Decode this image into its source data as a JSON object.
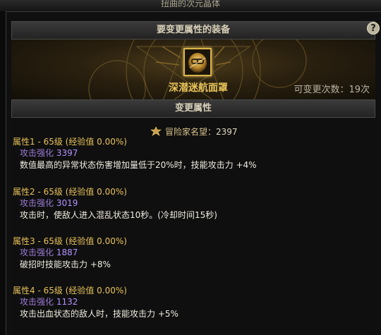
{
  "window": {
    "title": "扭曲的次元晶体"
  },
  "help": {
    "label": "?"
  },
  "equip_section": {
    "header": "要变更属性的装备",
    "item_name": "深潜迷航面罩",
    "change_count": "可变更次数：19次"
  },
  "attr_section": {
    "header": "变更属性",
    "renown_label": "冒险家名望：",
    "renown_value": "2397",
    "attributes": [
      {
        "title": "属性1 - 65级 (经验值 0.00%)",
        "enhance_label": "攻击强化",
        "enhance_value": "3397",
        "effect": "数值最高的异常状态伤害增加量低于20%时，技能攻击力 +4%"
      },
      {
        "title": "属性2 - 65级 (经验值 0.00%)",
        "enhance_label": "攻击强化",
        "enhance_value": "3019",
        "effect": "攻击时，使敌人进入混乱状态10秒。(冷却时间15秒)"
      },
      {
        "title": "属性3 - 65级 (经验值 0.00%)",
        "enhance_label": "攻击强化",
        "enhance_value": "1887",
        "effect": "破招时技能攻击力 +8%"
      },
      {
        "title": "属性4 - 65级 (经验值 0.00%)",
        "enhance_label": "攻击强化",
        "enhance_value": "1132",
        "effect": "攻击出血状态的敌人时，技能攻击力 +5%"
      }
    ]
  },
  "colors": {
    "gold": "#e8c25a",
    "purple": "#b392ff",
    "text": "#f0ece0"
  }
}
